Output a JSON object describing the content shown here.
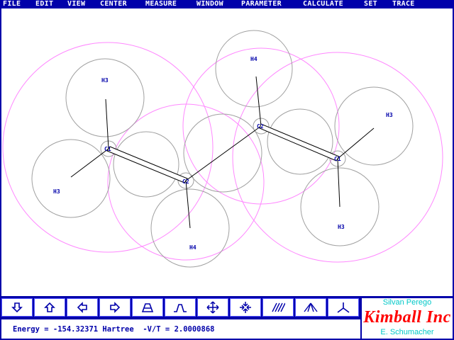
{
  "menu": [
    {
      "id": "file",
      "label": "FILE"
    },
    {
      "id": "edit",
      "label": "EDIT"
    },
    {
      "id": "view",
      "label": "VIEW"
    },
    {
      "id": "center",
      "label": "CENTER"
    },
    {
      "id": "measure",
      "label": "MEASURE"
    },
    {
      "id": "window",
      "label": "WINDOW"
    },
    {
      "id": "parameter",
      "label": "PARAMETER"
    },
    {
      "id": "calculate",
      "label": "CALCULATE"
    },
    {
      "id": "set",
      "label": "SET"
    },
    {
      "id": "trace",
      "label": "TRACE"
    }
  ],
  "molecule": {
    "atoms": [
      {
        "id": "c1a",
        "label": "C1"
      },
      {
        "id": "c2a",
        "label": "C2"
      },
      {
        "id": "c2b",
        "label": "C2"
      },
      {
        "id": "c1b",
        "label": "C1"
      },
      {
        "id": "h3a",
        "label": "H3"
      },
      {
        "id": "h3b",
        "label": "H3"
      },
      {
        "id": "h4a",
        "label": "H4"
      },
      {
        "id": "h4b",
        "label": "H4"
      },
      {
        "id": "h3c",
        "label": "H3"
      },
      {
        "id": "h3d",
        "label": "H3"
      }
    ]
  },
  "toolbar": [
    {
      "id": "arrow-down",
      "icon": "arrow-down-icon"
    },
    {
      "id": "arrow-up",
      "icon": "arrow-up-icon"
    },
    {
      "id": "arrow-left",
      "icon": "arrow-left-icon"
    },
    {
      "id": "arrow-right",
      "icon": "arrow-right-icon"
    },
    {
      "id": "tilt-forward",
      "icon": "tilt-forward-icon"
    },
    {
      "id": "tilt-back",
      "icon": "tilt-back-icon"
    },
    {
      "id": "move",
      "icon": "move-icon"
    },
    {
      "id": "shrink",
      "icon": "shrink-icon"
    },
    {
      "id": "hatch",
      "icon": "hatch-icon"
    },
    {
      "id": "perspective",
      "icon": "perspective-icon"
    },
    {
      "id": "axes",
      "icon": "axes-icon"
    }
  ],
  "status": {
    "text": "Energy = -154.32371 Hartree  -V/T = 2.0000868"
  },
  "branding": {
    "author1": "Silvan Perego",
    "company": "Kimball Inc",
    "author2": "E. Schumacher"
  },
  "colors": {
    "background": "#0000aa",
    "canvas": "#ffffff",
    "atom_circle": "#a0a0a0",
    "large_circle": "#ff88ff",
    "label": "#0000aa",
    "brand_red": "#ff0000",
    "brand_cyan": "#00c8c8"
  }
}
